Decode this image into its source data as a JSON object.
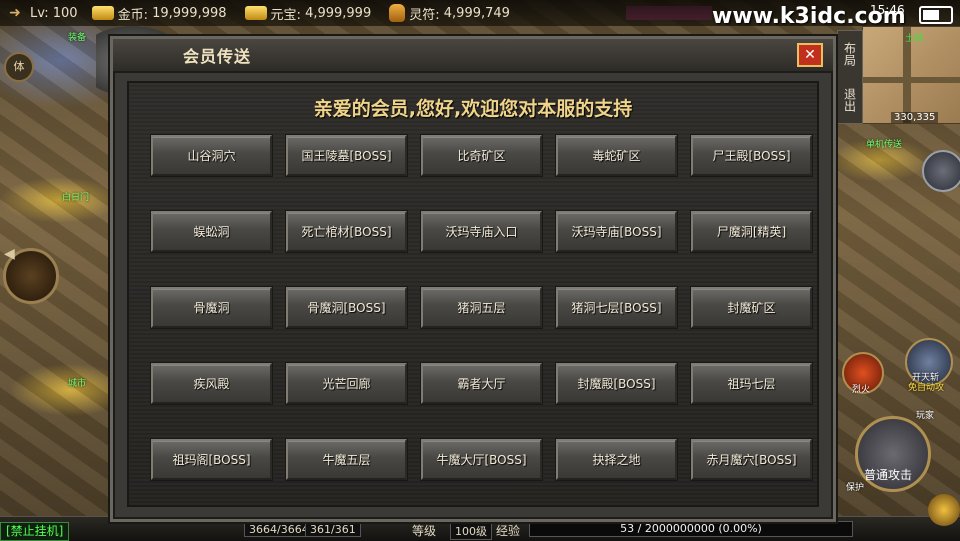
{
  "top_bar": {
    "level": "Lv: 100",
    "gold_label": "金币:",
    "gold_value": "19,999,998",
    "yuanbao_label": "元宝:",
    "yuanbao_value": "4,999,999",
    "lingfu_label": "灵符:",
    "lingfu_value": "4,999,749",
    "watermark": "www.k3idc.com",
    "clock": "15:46"
  },
  "left_panel": {
    "body_button": "体",
    "label_top": "装备",
    "label_mid": "白日门",
    "label_low": "城市",
    "ban_afk": "[禁止挂机]"
  },
  "modal": {
    "title": "会员传送",
    "close": "✕",
    "welcome": "亲爱的会员,您好,欢迎您对本服的支持",
    "destinations": [
      "山谷洞穴",
      "国王陵墓[BOSS]",
      "比奇矿区",
      "毒蛇矿区",
      "尸王殿[BOSS]",
      "蜈蚣洞",
      "死亡棺材[BOSS]",
      "沃玛寺庙入口",
      "沃玛寺庙[BOSS]",
      "尸魔洞[精英]",
      "骨魔洞",
      "骨魔洞[BOSS]",
      "猪洞五层",
      "猪洞七层[BOSS]",
      "封魔矿区",
      "疾风殿",
      "光芒回廊",
      "霸者大厅",
      "封魔殿[BOSS]",
      "祖玛七层",
      "祖玛阁[BOSS]",
      "牛魔五层",
      "牛魔大厅[BOSS]",
      "抉择之地",
      "赤月魔穴[BOSS]"
    ]
  },
  "right_panel": {
    "layout_tab": "布局",
    "exit_tab": "退出",
    "minimap_label": "土城",
    "coords": "330,335",
    "teleport_label": "单机传送",
    "skill_fire": "烈火",
    "skill_open_sky": "开天斩",
    "skill_open_sky_sub": "免自动攻",
    "skill_play": "玩家",
    "skill_guard": "保护",
    "attack": "普通攻击"
  },
  "bottom_bar": {
    "hp": "3664/3664",
    "mp": "361/361",
    "level_label": "等级",
    "level_value": "100级",
    "exp_label": "经验",
    "exp_value": "53 / 2000000000 (0.00%)"
  },
  "colors": {
    "accent_gold": "#f0d48a",
    "close_red": "#c0301c",
    "afk_green": "#50ff50"
  }
}
